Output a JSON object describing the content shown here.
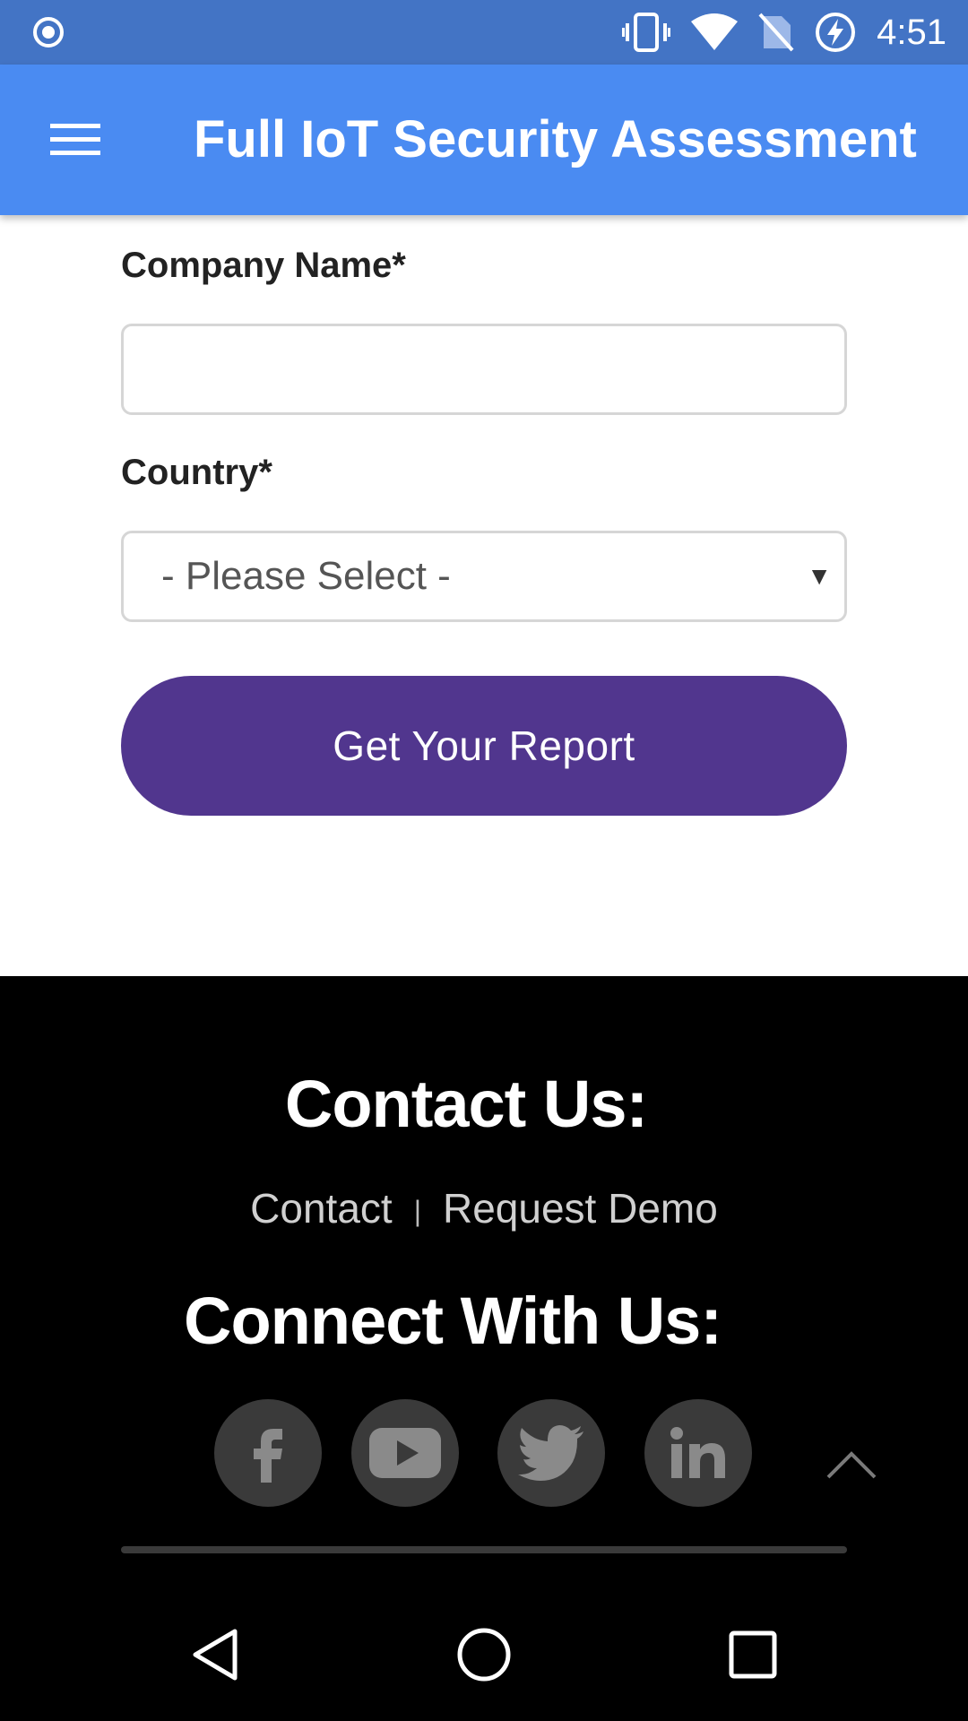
{
  "status_bar": {
    "time": "4:51",
    "icons": [
      "record-icon",
      "vibrate-icon",
      "wifi-icon",
      "no-sim-icon",
      "battery-charging-icon"
    ]
  },
  "app_bar": {
    "title": "Full IoT Security Assessment",
    "menu_icon": "hamburger-menu-icon",
    "background": "#4A8BF2"
  },
  "form": {
    "company_label": "Company Name*",
    "company_value": "",
    "country_label": "Country*",
    "country_selected": "- Please Select -",
    "country_arrow": "▼",
    "submit_label": "Get Your Report",
    "submit_color": "#51368E"
  },
  "footer": {
    "contact_heading": "Contact Us:",
    "links": [
      {
        "label": "Contact"
      },
      {
        "label": "Request Demo"
      }
    ],
    "separator": "|",
    "connect_heading": "Connect With Us:",
    "social": [
      {
        "icon": "facebook-icon"
      },
      {
        "icon": "youtube-icon"
      },
      {
        "icon": "twitter-icon"
      },
      {
        "icon": "linkedin-icon"
      }
    ],
    "scroll_top_icon": "chevron-up-icon"
  },
  "nav_bar": {
    "icons": [
      "back-icon",
      "home-icon",
      "recents-icon"
    ]
  }
}
